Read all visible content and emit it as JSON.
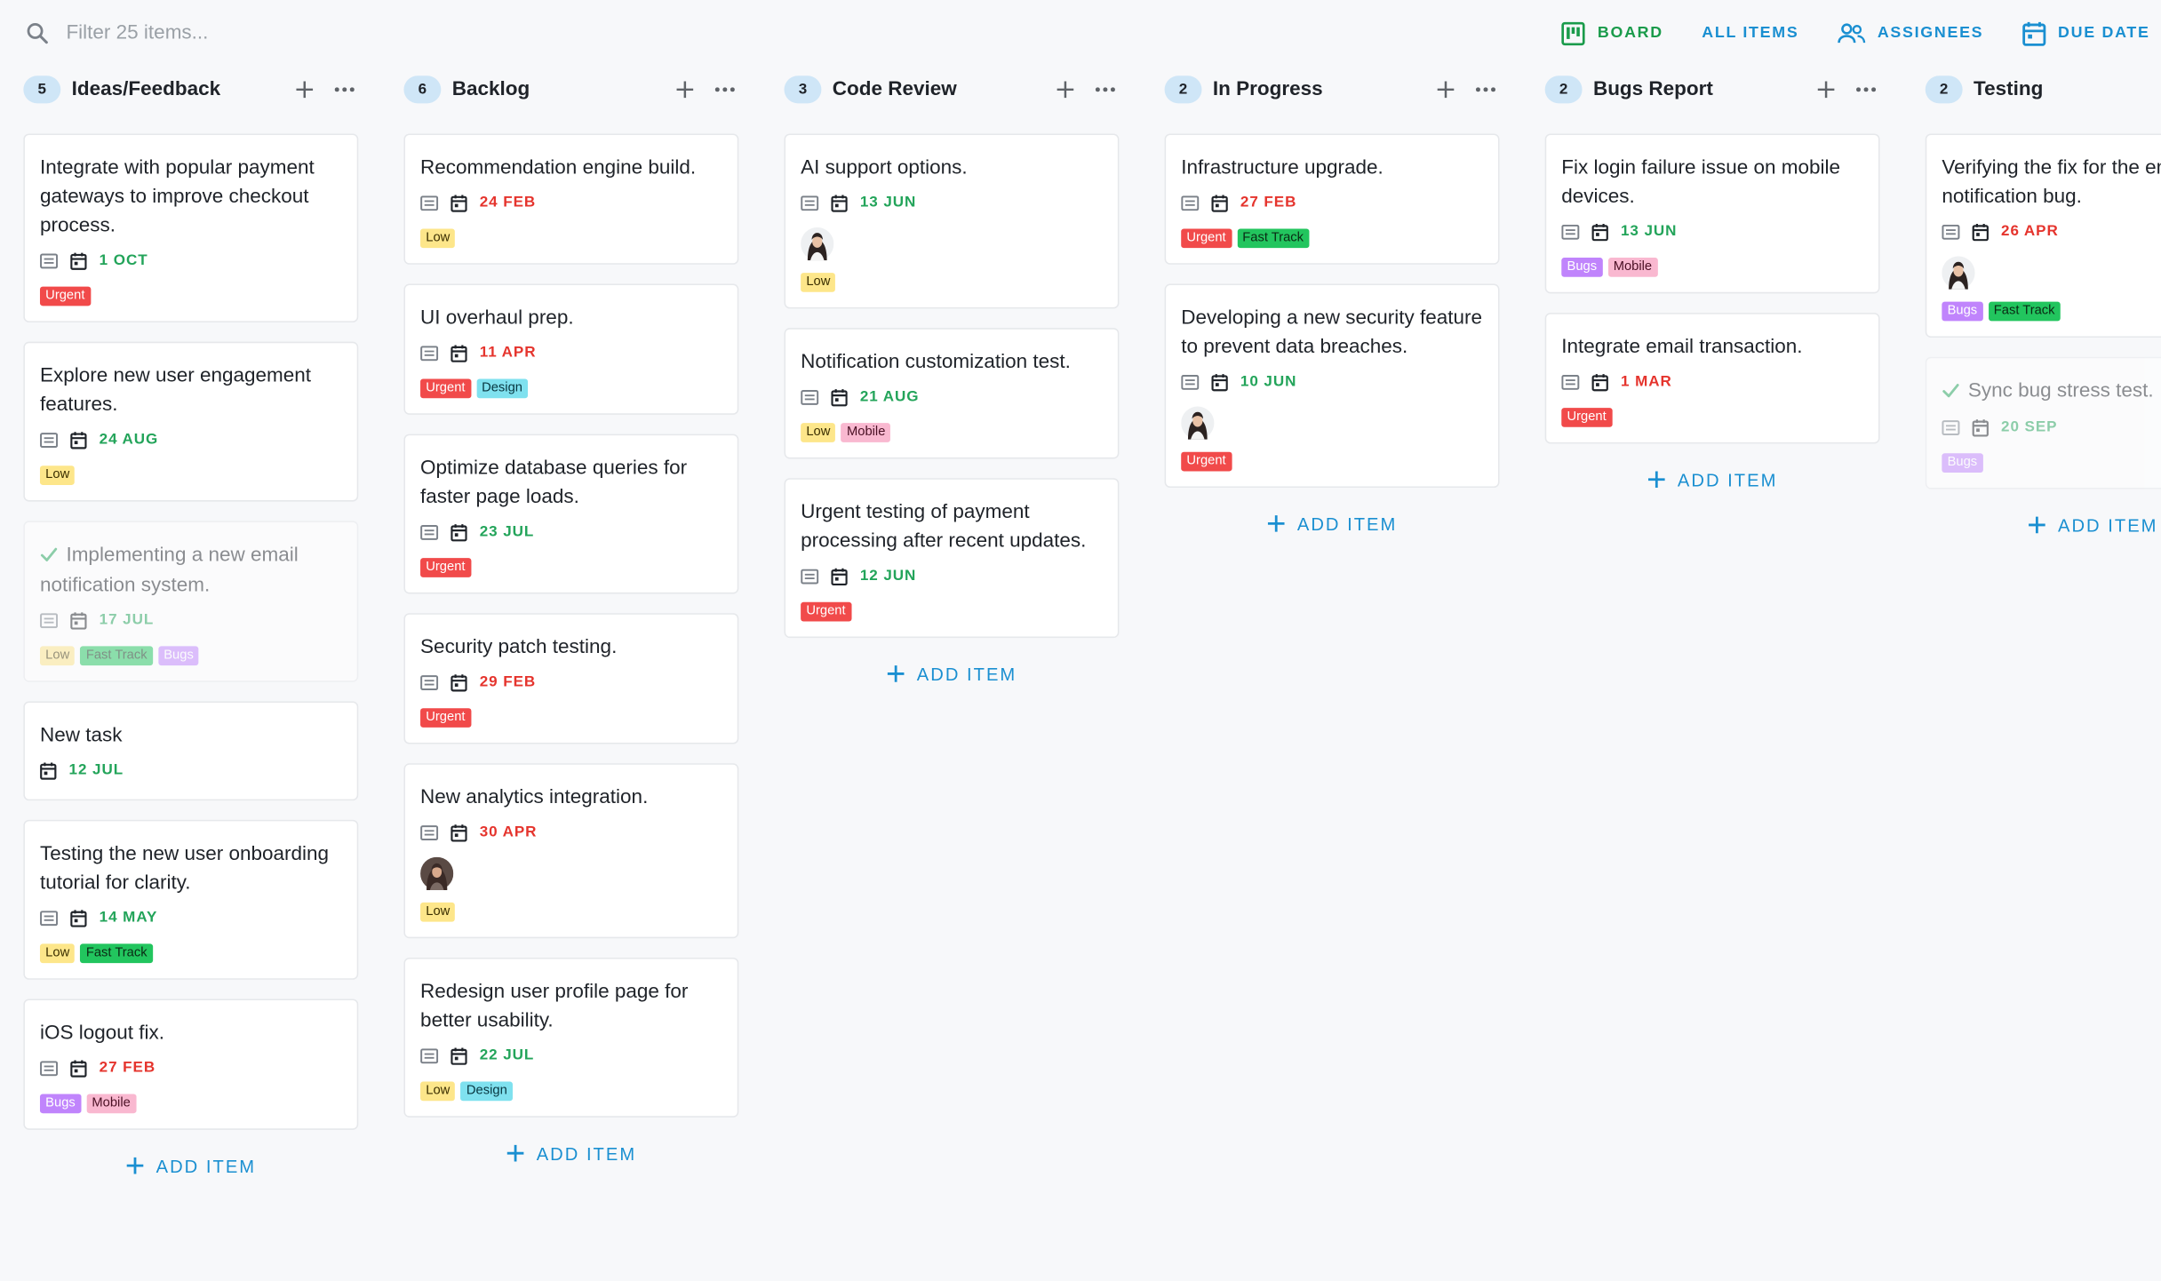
{
  "search": {
    "placeholder": "Filter 25 items..."
  },
  "views": {
    "board": "BOARD",
    "all_items": "ALL ITEMS",
    "assignees": "ASSIGNEES",
    "due_date": "DUE DATE"
  },
  "add_item_label": "ADD ITEM",
  "colors": {
    "accent": "#1a8fd1",
    "active_view": "#1a9b4b",
    "date_overdue": "#e5342d",
    "date_upcoming": "#23a45a",
    "count_badge": "#cfe6f7"
  },
  "columns": [
    {
      "title": "Ideas/Feedback",
      "count": "5",
      "cards": [
        {
          "title": "Integrate with popular payment gateways to improve checkout process.",
          "date": "1 OCT",
          "date_color": "green",
          "has_desc": true,
          "tags": [
            {
              "label": "Urgent",
              "kind": "urgent"
            }
          ]
        },
        {
          "title": "Explore new user engagement features.",
          "date": "24 AUG",
          "date_color": "green",
          "has_desc": true,
          "tags": [
            {
              "label": "Low",
              "kind": "low"
            }
          ]
        },
        {
          "title": "Implementing a new email notification system.",
          "date": "17 JUL",
          "date_color": "green",
          "has_desc": true,
          "done": true,
          "tags": [
            {
              "label": "Low",
              "kind": "low"
            },
            {
              "label": "Fast Track",
              "kind": "fasttrack"
            },
            {
              "label": "Bugs",
              "kind": "bugs"
            }
          ]
        },
        {
          "title": "New task",
          "date": "12 JUL",
          "date_color": "green",
          "has_desc": false,
          "tags": []
        },
        {
          "title": "Testing the new user onboarding tutorial for clarity.",
          "date": "14 MAY",
          "date_color": "green",
          "has_desc": true,
          "tags": [
            {
              "label": "Low",
              "kind": "low"
            },
            {
              "label": "Fast Track",
              "kind": "fasttrack"
            }
          ]
        },
        {
          "title": "iOS logout fix.",
          "date": "27 FEB",
          "date_color": "red",
          "has_desc": true,
          "tags": [
            {
              "label": "Bugs",
              "kind": "bugs"
            },
            {
              "label": "Mobile",
              "kind": "mobile"
            }
          ]
        }
      ]
    },
    {
      "title": "Backlog",
      "count": "6",
      "cards": [
        {
          "title": "Recommendation engine build.",
          "date": "24 FEB",
          "date_color": "red",
          "has_desc": true,
          "tags": [
            {
              "label": "Low",
              "kind": "low"
            }
          ]
        },
        {
          "title": "UI overhaul prep.",
          "date": "11 APR",
          "date_color": "red",
          "has_desc": true,
          "tags": [
            {
              "label": "Urgent",
              "kind": "urgent"
            },
            {
              "label": "Design",
              "kind": "design"
            }
          ]
        },
        {
          "title": "Optimize database queries for faster page loads.",
          "date": "23 JUL",
          "date_color": "green",
          "has_desc": true,
          "tags": [
            {
              "label": "Urgent",
              "kind": "urgent"
            }
          ]
        },
        {
          "title": "Security patch testing.",
          "date": "29 FEB",
          "date_color": "red",
          "has_desc": true,
          "tags": [
            {
              "label": "Urgent",
              "kind": "urgent"
            }
          ]
        },
        {
          "title": "New analytics integration.",
          "date": "30 APR",
          "date_color": "red",
          "has_desc": true,
          "avatar": "dark",
          "tags": [
            {
              "label": "Low",
              "kind": "low"
            }
          ]
        },
        {
          "title": "Redesign user profile page for better usability.",
          "date": "22 JUL",
          "date_color": "green",
          "has_desc": true,
          "tags": [
            {
              "label": "Low",
              "kind": "low"
            },
            {
              "label": "Design",
              "kind": "design"
            }
          ]
        }
      ]
    },
    {
      "title": "Code Review",
      "count": "3",
      "cards": [
        {
          "title": "AI support options.",
          "date": "13 JUN",
          "date_color": "green",
          "has_desc": true,
          "avatar": "light",
          "tags": [
            {
              "label": "Low",
              "kind": "low"
            }
          ]
        },
        {
          "title": "Notification customization test.",
          "date": "21 AUG",
          "date_color": "green",
          "has_desc": true,
          "tags": [
            {
              "label": "Low",
              "kind": "low"
            },
            {
              "label": "Mobile",
              "kind": "mobile"
            }
          ]
        },
        {
          "title": "Urgent testing of payment processing after recent updates.",
          "date": "12 JUN",
          "date_color": "green",
          "has_desc": true,
          "tags": [
            {
              "label": "Urgent",
              "kind": "urgent"
            }
          ]
        }
      ]
    },
    {
      "title": "In Progress",
      "count": "2",
      "cards": [
        {
          "title": "Infrastructure upgrade.",
          "date": "27 FEB",
          "date_color": "red",
          "has_desc": true,
          "tags": [
            {
              "label": "Urgent",
              "kind": "urgent"
            },
            {
              "label": "Fast Track",
              "kind": "fasttrack"
            }
          ]
        },
        {
          "title": "Developing a new security feature to prevent data breaches.",
          "date": "10 JUN",
          "date_color": "green",
          "has_desc": true,
          "avatar": "light",
          "tags": [
            {
              "label": "Urgent",
              "kind": "urgent"
            }
          ]
        }
      ]
    },
    {
      "title": "Bugs Report",
      "count": "2",
      "cards": [
        {
          "title": "Fix login failure issue on mobile devices.",
          "date": "13 JUN",
          "date_color": "green",
          "has_desc": true,
          "tags": [
            {
              "label": "Bugs",
              "kind": "bugs"
            },
            {
              "label": "Mobile",
              "kind": "mobile"
            }
          ]
        },
        {
          "title": "Integrate email transaction.",
          "date": "1 MAR",
          "date_color": "red",
          "has_desc": true,
          "tags": [
            {
              "label": "Urgent",
              "kind": "urgent"
            }
          ]
        }
      ]
    },
    {
      "title": "Testing",
      "count": "2",
      "cards": [
        {
          "title": "Verifying the fix for the email notification bug.",
          "date": "26 APR",
          "date_color": "red",
          "has_desc": true,
          "avatar": "light",
          "tags": [
            {
              "label": "Bugs",
              "kind": "bugs"
            },
            {
              "label": "Fast Track",
              "kind": "fasttrack"
            }
          ]
        },
        {
          "title": "Sync bug stress test.",
          "date": "20 SEP",
          "date_color": "green",
          "has_desc": true,
          "done": true,
          "tags": [
            {
              "label": "Bugs",
              "kind": "bugs"
            }
          ]
        }
      ]
    }
  ]
}
